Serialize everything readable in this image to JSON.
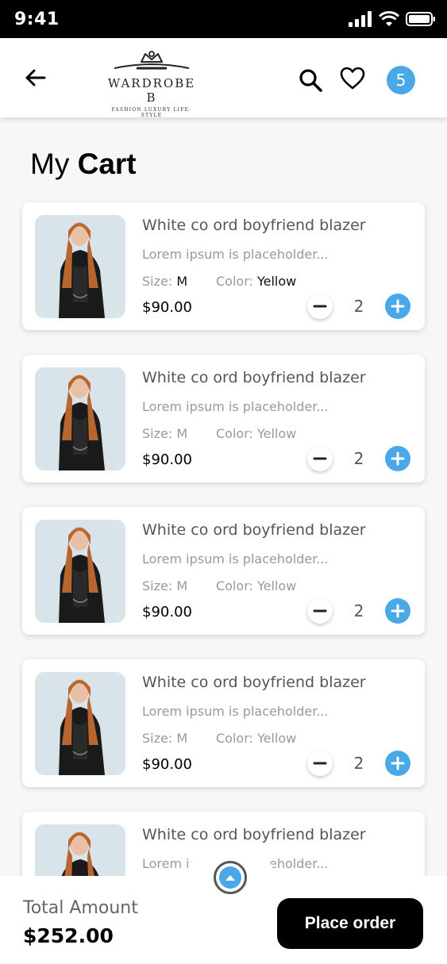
{
  "status_bar": {
    "time": "9:41"
  },
  "header": {
    "logo_name": "WARDROBE B",
    "logo_tagline": "FASHION LUXURY LIFE-STYLE",
    "cart_count": "5"
  },
  "page": {
    "title_light": "My",
    "title_bold": "Cart"
  },
  "cart_items": [
    {
      "title": "White co ord boyfriend blazer",
      "description": "Lorem ipsum is placeholder...",
      "size_label": "Size:",
      "size": "M",
      "color_label": "Color:",
      "color": "Yellow",
      "price": "$90.00",
      "quantity": "2"
    },
    {
      "title": "White co ord boyfriend blazer",
      "description": "Lorem ipsum is placeholder...",
      "size_label": "Size:",
      "size": "M",
      "color_label": "Color:",
      "color": "Yellow",
      "price": "$90.00",
      "quantity": "2"
    },
    {
      "title": "White co ord boyfriend blazer",
      "description": "Lorem ipsum is placeholder...",
      "size_label": "Size:",
      "size": "M",
      "color_label": "Color:",
      "color": "Yellow",
      "price": "$90.00",
      "quantity": "2"
    },
    {
      "title": "White co ord boyfriend blazer",
      "description": "Lorem ipsum is placeholder...",
      "size_label": "Size:",
      "size": "M",
      "color_label": "Color:",
      "color": "Yellow",
      "price": "$90.00",
      "quantity": "2"
    },
    {
      "title": "White co ord boyfriend blazer",
      "description": "Lorem ipsum is placeholder..."
    }
  ],
  "footer": {
    "total_label": "Total Amount",
    "total_value": "$252.00",
    "place_order_label": "Place order"
  },
  "icons": {
    "back": "arrow-left-icon",
    "search": "search-icon",
    "wishlist": "heart-icon",
    "minus": "minus-icon",
    "plus": "plus-icon",
    "scroll_up": "chevron-up-icon"
  },
  "colors": {
    "accent": "#4aa8e8",
    "button": "#000000",
    "background": "#f7f7f7"
  }
}
